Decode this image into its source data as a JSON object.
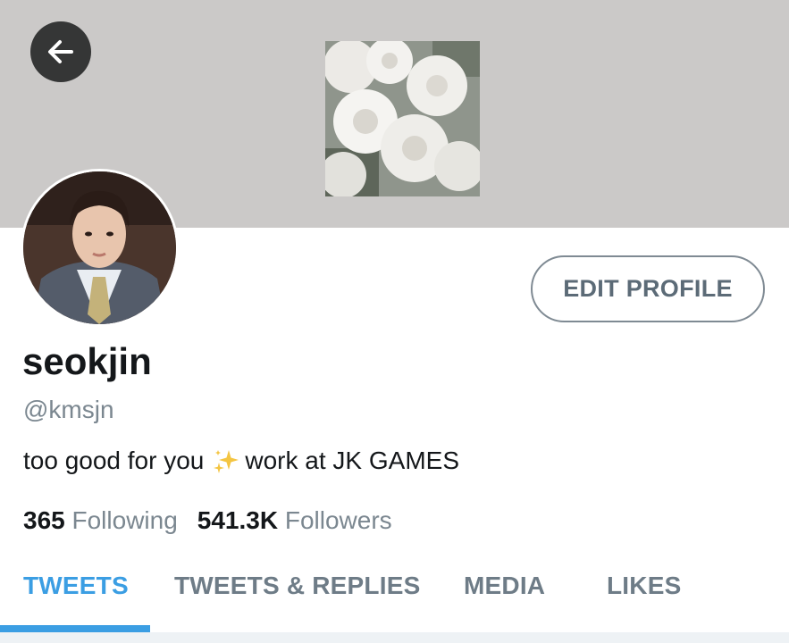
{
  "header": {
    "back_icon": "arrow-left-icon",
    "background_color": "#cbc9c8",
    "banner_image": "white-roses-photo"
  },
  "profile": {
    "avatar": "profile-photo",
    "edit_label": "EDIT PROFILE",
    "display_name": "seokjin",
    "handle": "@kmsjn",
    "bio_part1": "too good for you",
    "bio_emoji": "sparkles-emoji",
    "bio_part2": "work at JK GAMES",
    "following_count": "365",
    "following_label": "Following",
    "followers_count": "541.3K",
    "followers_label": "Followers"
  },
  "tabs": [
    {
      "label": "TWEETS",
      "active": true
    },
    {
      "label": "TWEETS & REPLIES",
      "active": false
    },
    {
      "label": "MEDIA",
      "active": false
    },
    {
      "label": "LIKES",
      "active": false
    }
  ],
  "colors": {
    "accent": "#3b9ee3",
    "muted": "#7b8790",
    "text": "#14171a"
  }
}
